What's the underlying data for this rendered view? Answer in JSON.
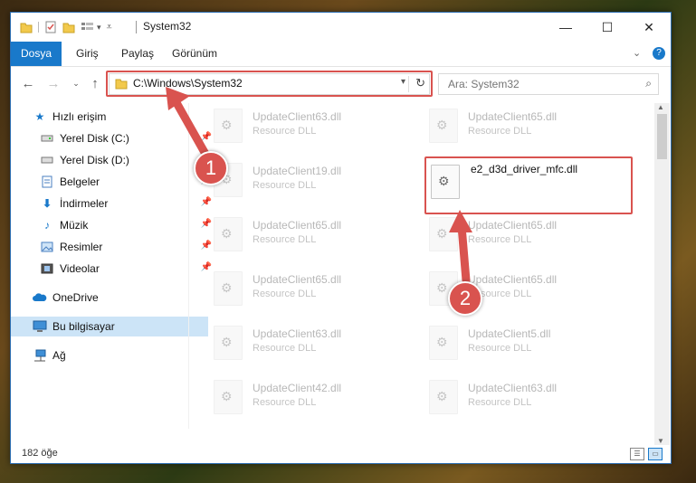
{
  "window": {
    "title": "System32",
    "controls": {
      "minimize": "—",
      "maximize": "☐",
      "close": "✕"
    }
  },
  "ribbon": {
    "tabs": [
      "Dosya",
      "Giriş",
      "Paylaş",
      "Görünüm"
    ],
    "active_tab": "Dosya",
    "expand_icon": "chevron-down-icon",
    "help_icon": "help-icon"
  },
  "navigation": {
    "back_icon": "back-arrow-icon",
    "forward_icon": "forward-arrow-icon",
    "recent_icon": "chevron-down-icon",
    "up_icon": "up-arrow-icon"
  },
  "address": {
    "path": "C:\\Windows\\System32"
  },
  "search": {
    "placeholder": "Ara: System32"
  },
  "sidebar": {
    "items": [
      {
        "label": "Hızlı erişim",
        "icon": "star-icon",
        "pinned": false
      },
      {
        "label": "Yerel Disk (C:)",
        "icon": "drive-icon",
        "pinned": true
      },
      {
        "label": "Yerel Disk (D:)",
        "icon": "drive-icon",
        "pinned": true
      },
      {
        "label": "Belgeler",
        "icon": "documents-icon",
        "pinned": true
      },
      {
        "label": "İndirmeler",
        "icon": "download-icon",
        "pinned": true
      },
      {
        "label": "Müzik",
        "icon": "music-icon",
        "pinned": true
      },
      {
        "label": "Resimler",
        "icon": "pictures-icon",
        "pinned": true
      },
      {
        "label": "Videolar",
        "icon": "videos-icon",
        "pinned": true
      },
      {
        "label": "OneDrive",
        "icon": "cloud-icon",
        "pinned": false
      },
      {
        "label": "Bu bilgisayar",
        "icon": "computer-icon",
        "pinned": false,
        "selected": true
      },
      {
        "label": "Ağ",
        "icon": "network-icon",
        "pinned": false
      }
    ]
  },
  "files": {
    "left_column": [
      {
        "name": "UpdateClient63.dll",
        "type": "Resource DLL"
      },
      {
        "name": "UpdateClient19.dll",
        "type": "Resource DLL"
      },
      {
        "name": "UpdateClient65.dll",
        "type": "Resource DLL"
      },
      {
        "name": "UpdateClient65.dll",
        "type": "Resource DLL"
      },
      {
        "name": "UpdateClient63.dll",
        "type": "Resource DLL"
      },
      {
        "name": "UpdateClient42.dll",
        "type": "Resource DLL"
      }
    ],
    "right_column": [
      {
        "name": "UpdateClient65.dll",
        "type": "Resource DLL"
      },
      {
        "name": "e2_d3d_driver_mfc.dll",
        "type": ""
      },
      {
        "name": "UpdateClient65.dll",
        "type": "Resource DLL"
      },
      {
        "name": "UpdateClient65.dll",
        "type": "Resource DLL"
      },
      {
        "name": "UpdateClient5.dll",
        "type": "Resource DLL"
      },
      {
        "name": "UpdateClient63.dll",
        "type": "Resource DLL"
      }
    ],
    "highlighted": "e2_d3d_driver_mfc.dll"
  },
  "status": {
    "count": "182 öğe"
  },
  "annotations": {
    "step1": "1",
    "step2": "2"
  },
  "colors": {
    "accent": "#1979ca",
    "highlight": "#d9534f",
    "selection": "#cce4f7"
  }
}
